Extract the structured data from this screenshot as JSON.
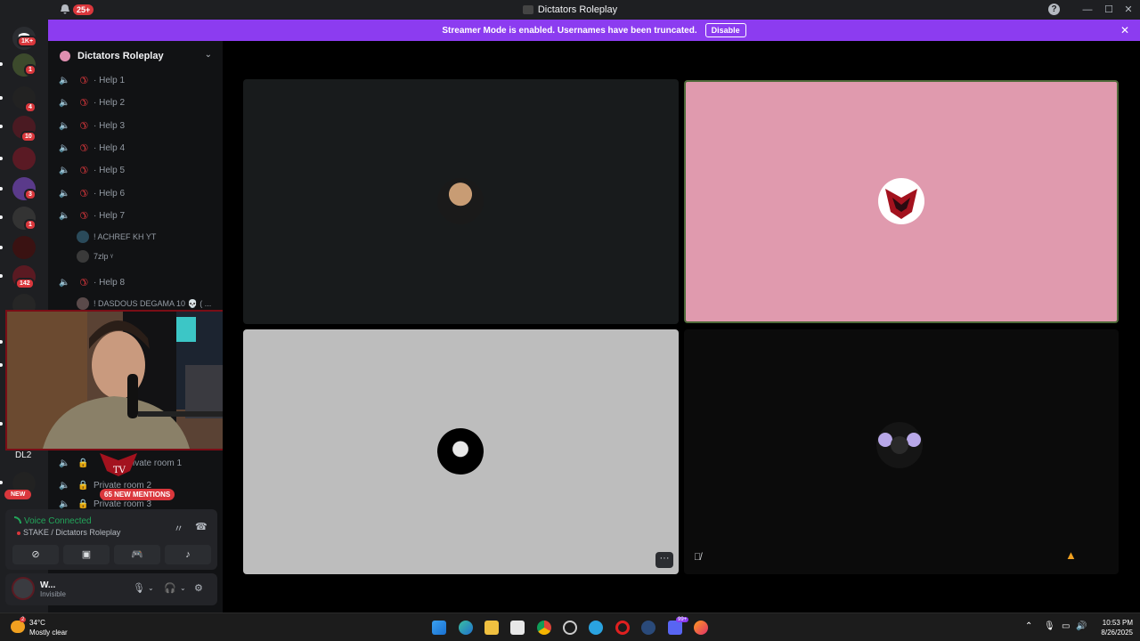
{
  "titlebar": {
    "notif_count": "25+",
    "window_title": "Dictators Roleplay",
    "help": "?",
    "min": "—",
    "max": "☐",
    "close": "✕"
  },
  "banner": {
    "text": "Streamer Mode is enabled. Usernames have been truncated.",
    "button": "Disable",
    "close": "✕"
  },
  "guild_badges": [
    "1K+",
    "1",
    "4",
    "10",
    "3",
    "1",
    "142"
  ],
  "guild_new": "NEW",
  "guild_dl2": "DL2",
  "server": {
    "name": "Dictators Roleplay",
    "chevron": "⌄"
  },
  "channels": [
    {
      "label": "Help 1"
    },
    {
      "label": "Help 2"
    },
    {
      "label": "Help 3"
    },
    {
      "label": "Help 4"
    },
    {
      "label": "Help 5"
    },
    {
      "label": "Help 6"
    },
    {
      "label": "Help 7"
    }
  ],
  "help7_members": [
    "! ACHREF KH YT",
    "7zlp ᵞ"
  ],
  "help8": {
    "label": "Help 8"
  },
  "help8_members": [
    "! DASDOUS DEGAMA 10 💀 ( ..."
  ],
  "private_rooms": [
    {
      "label": "Private room 1"
    },
    {
      "label": "Private room 2"
    },
    {
      "label": "Private room 3"
    }
  ],
  "mentions": "65 NEW MENTIONS",
  "voice": {
    "status": "Voice Connected",
    "channel": "STAKE / Dictators Roleplay"
  },
  "user": {
    "name": "W...",
    "status": "Invisible"
  },
  "taskbar": {
    "weather_badge": "2",
    "temp": "34°C",
    "condition": "Mostly clear",
    "time": "10:53 PM",
    "date": "8/26/2025",
    "steam_badge": "99+"
  },
  "colors": {
    "banner": "#8c3cf0",
    "tile_pink": "#e09aae",
    "tile_gray": "#bdbdbd",
    "tile_dark": "#181b1c",
    "voice_green": "#23a55a",
    "danger": "#da373c"
  }
}
